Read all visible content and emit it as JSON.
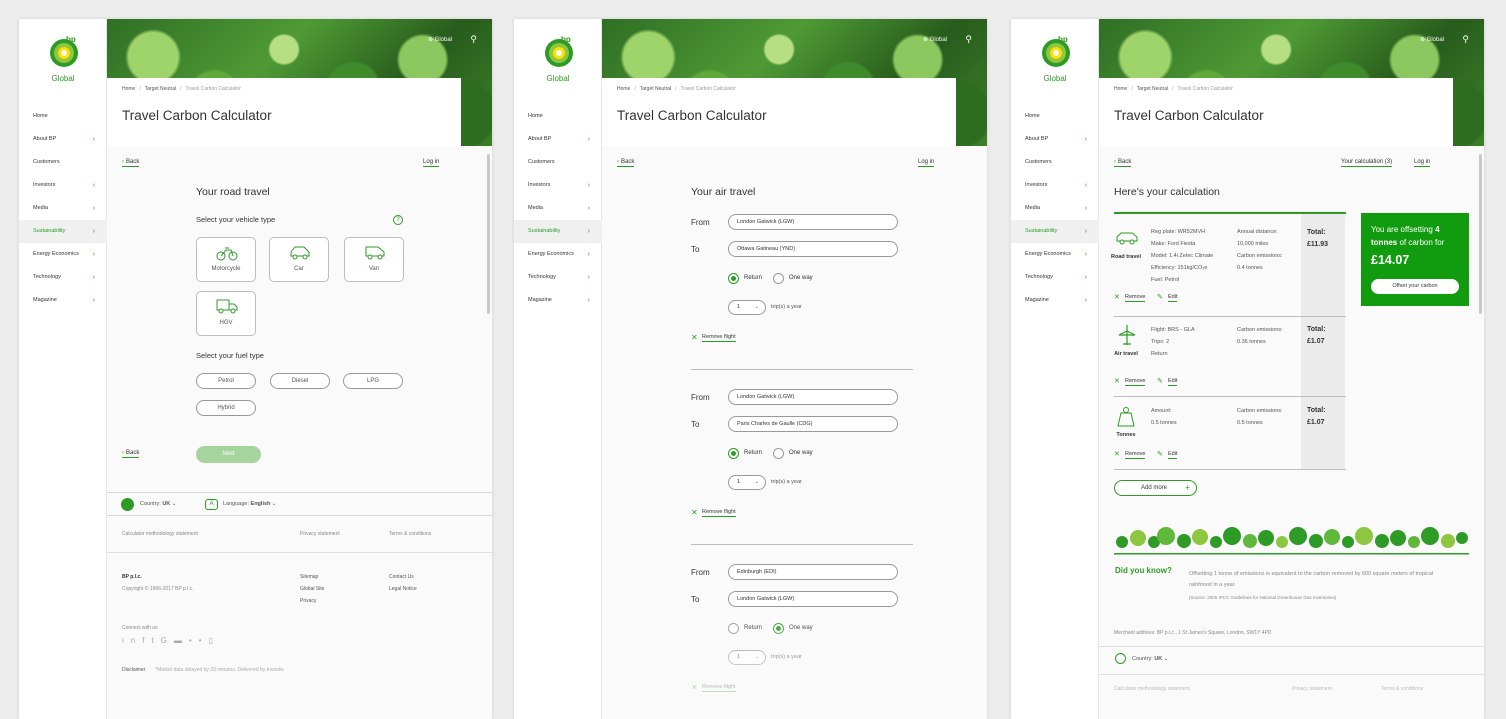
{
  "brand": {
    "bp": "bp",
    "name": "Global"
  },
  "nav": [
    "Home",
    "About BP",
    "Customers",
    "Investors",
    "Media",
    "Sustainability",
    "Energy Economics",
    "Technology",
    "Magazine"
  ],
  "nav_active": "Sustainability",
  "header": {
    "global": "Global"
  },
  "breadcrumb": {
    "home": "Home",
    "parent": "Target Neutral",
    "current": "Travel Carbon Calculator"
  },
  "title": "Travel Carbon Calculator",
  "back": "Back",
  "login": "Log in",
  "road": {
    "heading": "Your road travel",
    "vehicle_label": "Select your vehicle type",
    "help": "?",
    "vehicles": [
      "Motorcycle",
      "Car",
      "Van",
      "HGV"
    ],
    "fuel_label": "Select your fuel type",
    "fuels": [
      "Petrol",
      "Diesel",
      "LPG",
      "Hybrid"
    ],
    "next": "Next",
    "country_label": "Country:",
    "country": "UK",
    "language_label": "Language:",
    "language": "English",
    "footer": {
      "methodology": "Calculator methodology statement",
      "privacy": "Privacy statement",
      "terms": "Terms & conditions",
      "company": "BP p.l.c.",
      "copyright": "Copyright © 1996-2017 BP p.l.c.",
      "sitemap": "Sitemap",
      "global_site": "Global Site",
      "privacy_link": "Privacy",
      "contact": "Contact Us",
      "legal": "Legal Notice",
      "connect": "Connect with us",
      "disclaimer": "Disclaimer",
      "disclaimer_note": "*Market data delayed by 20 minutes. Delivered by Investis"
    }
  },
  "air": {
    "heading": "Your air travel",
    "from_label": "From",
    "to_label": "To",
    "return_label": "Return",
    "oneway_label": "One way",
    "trips_label": "trip(s) a year",
    "remove": "Remove flight",
    "flights": [
      {
        "from": "London Gatwick (LGW)",
        "to": "Ottawa Gatineau (YND)",
        "trips": "1",
        "type": "Return"
      },
      {
        "from": "London Gatwick (LGW)",
        "to": "Paris Charles de Gaulle (CDG)",
        "trips": "1",
        "type": "Return"
      },
      {
        "from": "Edinburgh (EDI)",
        "to": "London Gatwick (LGW)",
        "trips": "1",
        "type": "One way"
      }
    ]
  },
  "result": {
    "your_calc": "Your calculation (3)",
    "heading": "Here's your calculation",
    "rows": [
      {
        "label": "Road travel",
        "details": [
          "Reg plate: WR52MVH",
          "Make: Ford Fiesta",
          "Model: 1.4i Zetec Climate",
          "Efficiency: 151kg/CO₂e",
          "Fuel: Petrol"
        ],
        "stats": [
          "Annual distance:",
          "10,000 miles",
          "Carbon emissions:",
          "0.4 tonnes"
        ],
        "total_label": "Total:",
        "total": "£11.93"
      },
      {
        "label": "Air travel",
        "details": [
          "Flight: BRS - GLA",
          "Trips: 2",
          "Return"
        ],
        "stats": [
          "Carbon emissions:",
          "0.36 tonnes"
        ],
        "total_label": "Total:",
        "total": "£1.07"
      },
      {
        "label": "Tonnes",
        "details": [
          "Amount:",
          "0.5 tonnes"
        ],
        "stats": [
          "Carbon emissions:",
          "0.5 tonnes"
        ],
        "total_label": "Total:",
        "total": "£1.07"
      }
    ],
    "remove": "Remove",
    "edit": "Edit",
    "add_more": "Add more",
    "offset_text_1": "You are offsetting ",
    "offset_bold": "4 tonnes",
    "offset_text_2": " of carbon for",
    "offset_amount": "£14.07",
    "offset_button": "Offset your carbon",
    "did_you_know": "Did you know?",
    "fact": "Offsetting 1 tonne of emissions is equivalent to the carbon removed by 600 square meters of tropical rainforest in a year.",
    "source": "(Source: 2006 IPCC Guidelines for National Greenhouse Gas Inventories)",
    "merchant": "Merchant address: BP p.l.c., 1 St James's Square, London, SW1Y 4PD",
    "country_label": "Country:",
    "country": "UK"
  },
  "colors": {
    "brand_green": "#2e9b27",
    "offset_green": "#109c0e",
    "next_disabled": "#a6d49d"
  }
}
